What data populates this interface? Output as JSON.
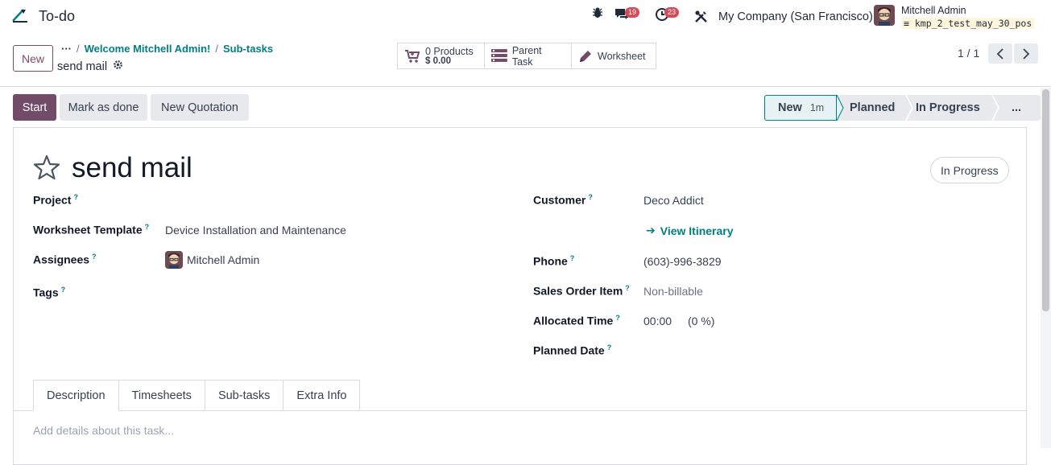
{
  "app": {
    "name": "To-do"
  },
  "systray": {
    "messages_count": "19",
    "activities_count": "23",
    "company": "My Company (San Francisco)",
    "user_name": "Mitchell Admin",
    "database": "kmp_2_test_may_30_pos"
  },
  "control": {
    "new_label": "New",
    "breadcrumbs": [
      "Welcome Mitchell Admin!",
      "Sub-tasks"
    ],
    "record_name": "send mail",
    "smart_buttons": {
      "products_count": "0 Products",
      "products_amount": "$ 0.00",
      "parent_task": "Parent Task",
      "worksheet": "Worksheet"
    },
    "pager": "1 / 1"
  },
  "statusbar": {
    "start": "Start",
    "mark_done": "Mark as done",
    "new_quotation": "New Quotation",
    "stages": [
      {
        "name": "New",
        "duration": "1m"
      },
      {
        "name": "Planned"
      },
      {
        "name": "In Progress"
      },
      {
        "name": "..."
      }
    ]
  },
  "form": {
    "title": "send mail",
    "state": "In Progress",
    "left": {
      "project_label": "Project",
      "worksheet_template_label": "Worksheet Template",
      "worksheet_template_value": "Device Installation and Maintenance",
      "assignees_label": "Assignees",
      "assignees_value": "Mitchell Admin",
      "tags_label": "Tags"
    },
    "right": {
      "customer_label": "Customer",
      "customer_value": "Deco Addict",
      "itinerary_link": "View Itinerary",
      "phone_label": "Phone",
      "phone_value": "(603)-996-3829",
      "sale_line_label": "Sales Order Item",
      "sale_line_value": "Non-billable",
      "allocated_label": "Allocated Time",
      "allocated_value": "00:00",
      "allocated_percent": "(0 %)",
      "planned_label": "Planned Date"
    },
    "help_mark": "?",
    "tabs": [
      "Description",
      "Timesheets",
      "Sub-tasks",
      "Extra Info"
    ],
    "description_placeholder": "Add details about this task..."
  },
  "colors": {
    "primary": "#714b67",
    "link": "#017e84",
    "badge": "#d44c59"
  }
}
